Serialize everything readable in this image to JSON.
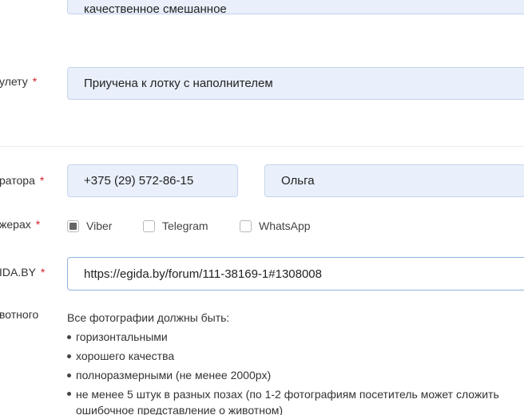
{
  "fields": {
    "breed_value": "качественное смешанное",
    "toilet_label": "улету",
    "toilet_value": "Приучена к лотку с наполнителем",
    "curator_label": "ратора",
    "phone_value": "+375 (29) 572-86-15",
    "name_value": "Ольга",
    "messengers_label": "жерах",
    "egida_label": "IDA.BY",
    "egida_value": "https://egida.by/forum/111-38169-1#1308008",
    "photos_label": "вотного",
    "required_mark": "*"
  },
  "messengers": [
    {
      "label": "Viber",
      "checked": true
    },
    {
      "label": "Telegram",
      "checked": false
    },
    {
      "label": "WhatsApp",
      "checked": false
    }
  ],
  "photo_info": {
    "intro": "Все фотографии должны быть:",
    "items": [
      "горизонтальными",
      "хорошего качества",
      "полноразмерными (не менее 2000px)",
      "не менее 5 штук в разных позах (по 1-2 фотографиям посетитель может сложить ошибочное представление о животном)"
    ]
  },
  "colors": {
    "input_bg": "#e9f0fb",
    "input_border": "#c4d4ea",
    "required": "#d21f26"
  }
}
